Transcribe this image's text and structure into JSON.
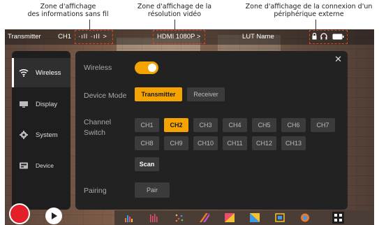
{
  "annotations": {
    "wireless_zone": [
      "Zone d'affichage",
      "des informations sans fil"
    ],
    "video_zone": [
      "Zone d'affichage de la",
      "résolution vidéo"
    ],
    "peripheral_zone": [
      "Zone d'affichage de la connexion d'un",
      "périphérique externe"
    ]
  },
  "statusbar": {
    "mode": "Transmitter",
    "channel": "CH1",
    "signal": "·ıll ·ıll >",
    "video": "HDMI 1080P >",
    "lut": "LUT Name"
  },
  "sidebar": {
    "items": [
      {
        "label": "Wireless",
        "icon": "wifi-icon"
      },
      {
        "label": "Display",
        "icon": "monitor-icon"
      },
      {
        "label": "System",
        "icon": "gear-icon"
      },
      {
        "label": "Device",
        "icon": "device-icon"
      }
    ]
  },
  "panel": {
    "close": "✕",
    "wireless_label": "Wireless",
    "wireless_on": true,
    "device_mode_label": "Device Mode",
    "modes": [
      "Transmitter",
      "Receiver"
    ],
    "selected_mode": "Transmitter",
    "channel_label_1": "Channel",
    "channel_label_2": "Switch",
    "channels": [
      "CH1",
      "CH2",
      "CH3",
      "CH4",
      "CH5",
      "CH6",
      "CH7",
      "CH8",
      "CH9",
      "CH10",
      "CH11",
      "CH12",
      "CH13"
    ],
    "selected_channel": "CH2",
    "scan_label": "Scan",
    "pairing_label": "Pairing",
    "pair_label": "Pair"
  },
  "colors": {
    "accent": "#f5a300",
    "record": "#e3202a",
    "annotation_box": "#e2451f"
  }
}
